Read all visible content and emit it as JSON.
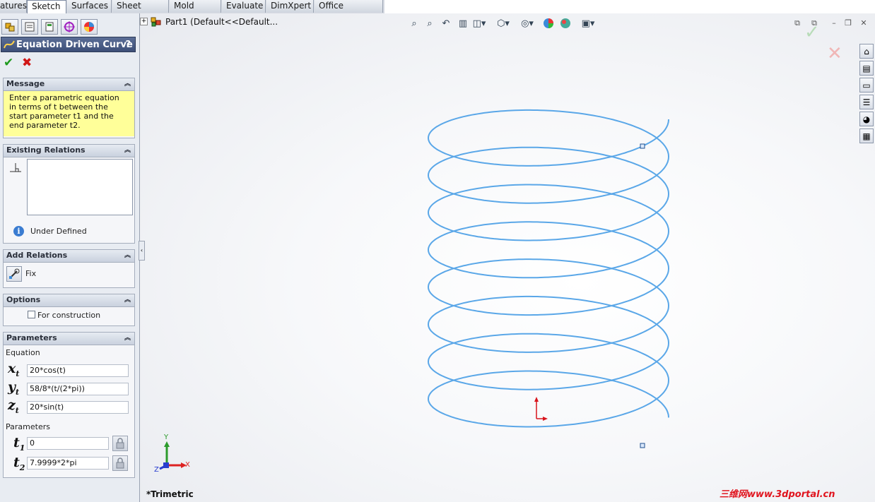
{
  "command_tabs": [
    "atures",
    "Sketch",
    "Surfaces",
    "Sheet Metal",
    "Mold Tools",
    "Evaluate",
    "DimXpert",
    "Office Products"
  ],
  "active_tab": "Sketch",
  "feature_tree": {
    "part_label": "Part1  (Default<<Default..."
  },
  "property_manager": {
    "title": "Equation Driven Curve",
    "help": "?",
    "ok_icon": "check-icon",
    "cancel_icon": "x-icon",
    "message": {
      "header": "Message",
      "text": "Enter a parametric equation in terms of t between the start parameter t1 and the end parameter t2."
    },
    "existing_relations": {
      "header": "Existing Relations",
      "status": "Under Defined"
    },
    "add_relations": {
      "header": "Add Relations",
      "fix_label": "Fix"
    },
    "options": {
      "header": "Options",
      "for_construction_label": "For construction",
      "for_construction_checked": false
    },
    "parameters": {
      "header": "Parameters",
      "equation_label": "Equation",
      "xt": "20*cos(t)",
      "yt": "58/8*(t/(2*pi))",
      "zt": "20*sin(t)",
      "parameters_label": "Parameters",
      "t1": "0",
      "t2": "7.9999*2*pi"
    }
  },
  "viewport": {
    "view_name": "*Trimetric",
    "triad": {
      "x": "X",
      "y": "Y",
      "z": "Z"
    },
    "curve_color": "#5aa7e8",
    "watermark": "三维网www.3dportal.cn"
  },
  "colors": {
    "title_bar": "#3d4f78",
    "message_bg": "#ffff99",
    "accent_red": "#e0141e"
  }
}
